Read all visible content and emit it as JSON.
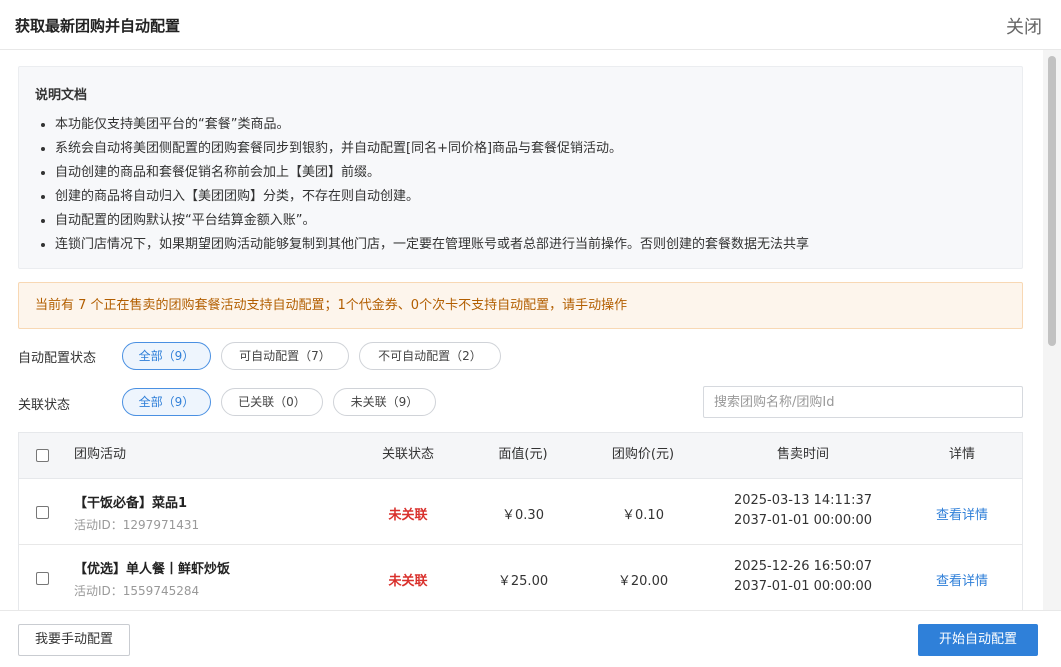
{
  "dialog": {
    "title": "获取最新团购并自动配置",
    "close_label": "关闭"
  },
  "doc": {
    "title": "说明文档",
    "items": [
      "本功能仅支持美团平台的“套餐”类商品。",
      "系统会自动将美团侧配置的团购套餐同步到银豹，并自动配置[同名+同价格]商品与套餐促销活动。",
      "自动创建的商品和套餐促销名称前会加上【美团】前缀。",
      "创建的商品将自动归入【美团团购】分类，不存在则自动创建。",
      "自动配置的团购默认按“平台结算金额入账”。",
      "连锁门店情况下，如果期望团购活动能够复制到其他门店，一定要在管理账号或者总部进行当前操作。否则创建的套餐数据无法共享"
    ]
  },
  "notice": {
    "text": "当前有 7 个正在售卖的团购套餐活动支持自动配置；1个代金券、0个次卡不支持自动配置，请手动操作"
  },
  "filters": {
    "auto_config": {
      "label": "自动配置状态",
      "options": [
        "全部（9）",
        "可自动配置（7）",
        "不可自动配置（2）"
      ],
      "selected": 0
    },
    "link_status": {
      "label": "关联状态",
      "options": [
        "全部（9）",
        "已关联（0）",
        "未关联（9）"
      ],
      "selected": 0
    },
    "search_placeholder": "搜索团购名称/团购Id"
  },
  "table": {
    "headers": [
      "团购活动",
      "关联状态",
      "面值(元)",
      "团购价(元)",
      "售卖时间",
      "详情"
    ],
    "rows": [
      {
        "name": "【干饭必备】菜品1",
        "activity_id": "活动ID：1297971431",
        "status": "未关联",
        "face_value": "￥0.30",
        "group_price": "￥0.10",
        "sale_start": "2025-03-13 14:11:37",
        "sale_end": "2037-01-01 00:00:00",
        "detail": "查看详情"
      },
      {
        "name": "【优选】单人餐丨鲜虾炒饭",
        "activity_id": "活动ID：1559745284",
        "status": "未关联",
        "face_value": "￥25.00",
        "group_price": "￥20.00",
        "sale_start": "2025-12-26 16:50:07",
        "sale_end": "2037-01-01 00:00:00",
        "detail": "查看详情"
      }
    ]
  },
  "footer": {
    "manual_label": "我要手动配置",
    "auto_label": "开始自动配置"
  },
  "colors": {
    "primary": "#2f80d9",
    "danger": "#d9302c",
    "notice_text": "#b25e00",
    "notice_bg": "#fdf5ec"
  }
}
